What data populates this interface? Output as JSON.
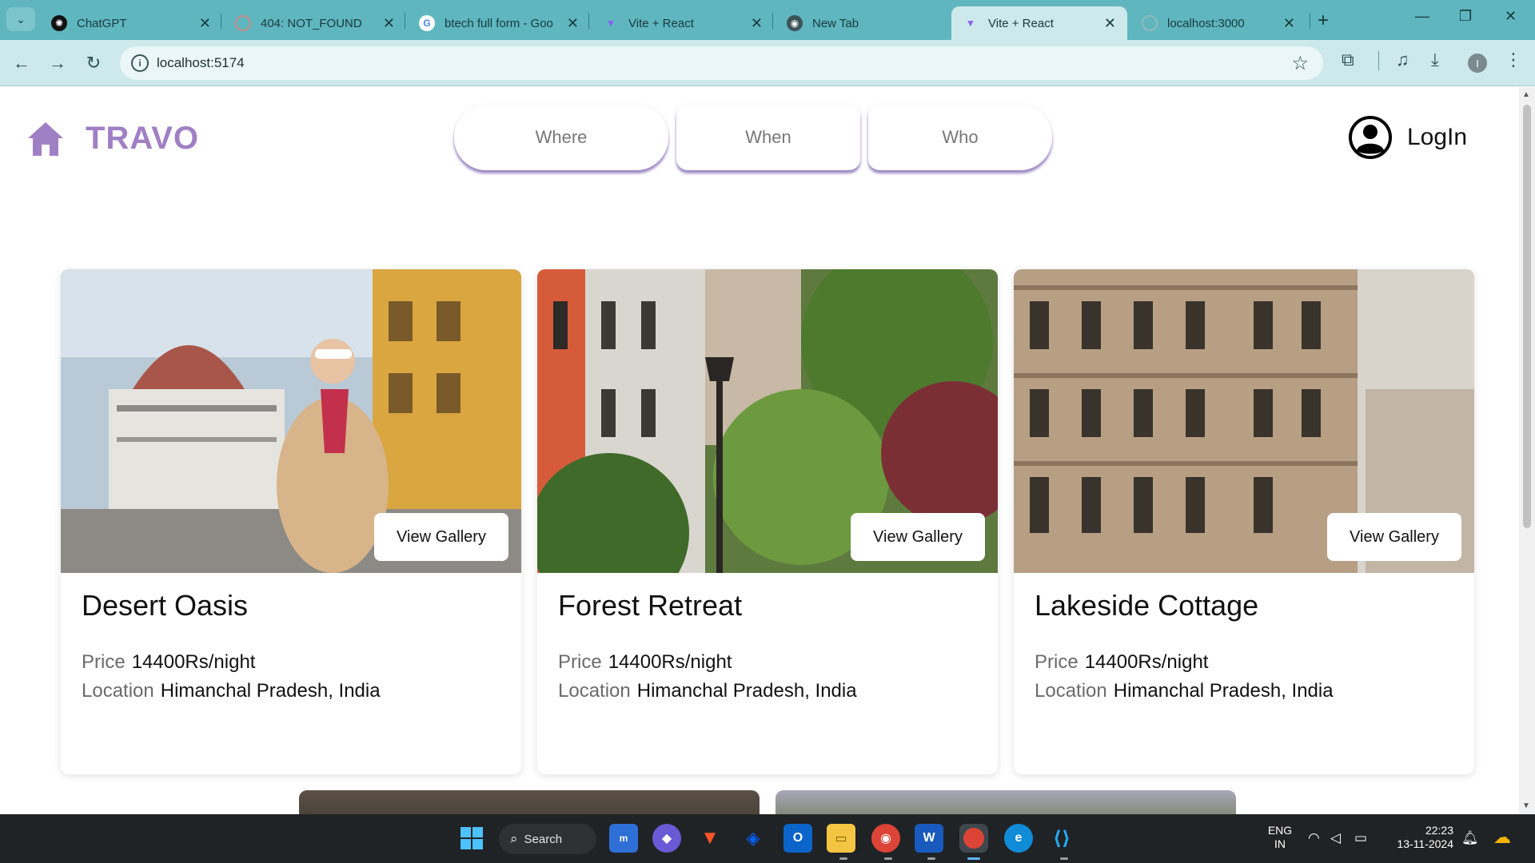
{
  "browser": {
    "tabs": [
      {
        "label": "ChatGPT",
        "icon": "chatgpt-icon",
        "active": false
      },
      {
        "label": "404: NOT_FOUND",
        "icon": "vercel-icon",
        "active": false
      },
      {
        "label": "btech full form - Goo",
        "icon": "google-icon",
        "active": false
      },
      {
        "label": "Vite + React",
        "icon": "vite-icon",
        "active": false
      },
      {
        "label": "New Tab",
        "icon": "chrome-icon",
        "active": false
      },
      {
        "label": "Vite + React",
        "icon": "vite-icon",
        "active": true
      },
      {
        "label": "localhost:3000",
        "icon": "globe-icon",
        "active": false
      }
    ],
    "url": "localhost:5174",
    "profile_initial": "I",
    "accent_color": "#5fb6be"
  },
  "app": {
    "brand": "TRAVO",
    "brand_color": "#a080c4",
    "search": {
      "where": "Where",
      "when": "When",
      "who": "Who"
    },
    "login_label": "LogIn"
  },
  "cards": [
    {
      "title": "Desert Oasis",
      "price_label": "Price",
      "price": "14400Rs/night",
      "location_label": "Location",
      "location": "Himanchal Pradesh, India",
      "button": "View Gallery"
    },
    {
      "title": "Forest Retreat",
      "price_label": "Price",
      "price": "14400Rs/night",
      "location_label": "Location",
      "location": "Himanchal Pradesh, India",
      "button": "View Gallery"
    },
    {
      "title": "Lakeside Cottage",
      "price_label": "Price",
      "price": "14400Rs/night",
      "location_label": "Location",
      "location": "Himanchal Pradesh, India",
      "button": "View Gallery"
    }
  ],
  "taskbar": {
    "search_label": "Search",
    "apps": [
      "start-icon",
      "mylp-icon",
      "copilot-icon",
      "brave-icon",
      "dropbox-icon",
      "outlook-icon",
      "file-explorer-icon",
      "chrome-icon",
      "word-icon",
      "chrome-profile-icon",
      "edge-icon",
      "vscode-icon"
    ],
    "lang_line1": "ENG",
    "lang_line2": "IN",
    "time": "22:23",
    "date": "13-11-2024"
  }
}
